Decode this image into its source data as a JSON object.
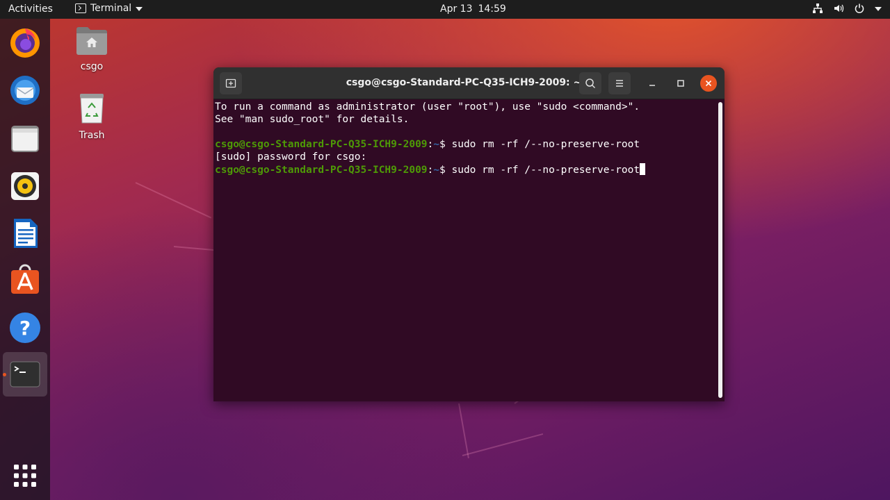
{
  "topbar": {
    "activities": "Activities",
    "app_name": "Terminal",
    "date": "Apr 13",
    "time": "14:59"
  },
  "dock": {
    "items": [
      {
        "name": "firefox-icon"
      },
      {
        "name": "thunderbird-icon"
      },
      {
        "name": "files-icon"
      },
      {
        "name": "rhythmbox-icon"
      },
      {
        "name": "libreoffice-writer-icon"
      },
      {
        "name": "ubuntu-software-icon"
      },
      {
        "name": "help-icon"
      },
      {
        "name": "terminal-icon",
        "running": true
      },
      {
        "name": "show-applications-icon"
      }
    ]
  },
  "desktop": {
    "home_label": "csgo",
    "trash_label": "Trash"
  },
  "terminal": {
    "title": "csgo@csgo-Standard-PC-Q35-ICH9-2009: ~",
    "lines": [
      "To run a command as administrator (user \"root\"), use \"sudo <command>\".",
      "See \"man sudo_root\" for details."
    ],
    "prompt_user": "csgo@csgo-Standard-PC-Q35-ICH9-2009",
    "prompt_sep": ":",
    "prompt_path": "~",
    "prompt_dollar": "$ ",
    "command_1": "sudo rm -rf /--no-preserve-root",
    "sudo_prompt": "[sudo] password for csgo:",
    "command_2": "sudo rm -rf /--no-preserve-root"
  },
  "colors": {
    "terminal_bg": "#300a24",
    "prompt_user": "#4e9a06",
    "prompt_path": "#3465a4",
    "close_button": "#e95420"
  }
}
